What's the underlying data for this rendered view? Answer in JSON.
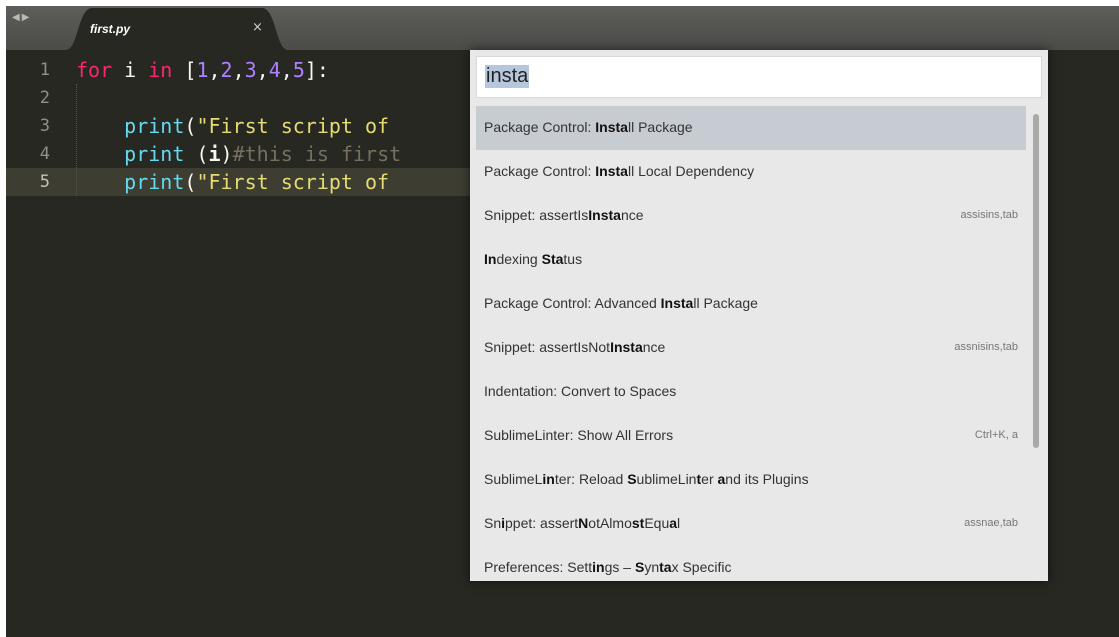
{
  "tabs": [
    {
      "title": "first.py",
      "close": "×"
    }
  ],
  "nav_arrows": "◀▶",
  "editor": {
    "line_numbers": [
      "1",
      "2",
      "3",
      "4",
      "5"
    ],
    "active_line": "5"
  },
  "palette": {
    "query": "insta",
    "results": [
      {
        "segments": [
          {
            "t": "Package Control: ",
            "b": false
          },
          {
            "t": "Insta",
            "b": true
          },
          {
            "t": "ll Package",
            "b": false
          }
        ],
        "hint": ""
      },
      {
        "segments": [
          {
            "t": "Package Control: ",
            "b": false
          },
          {
            "t": "Insta",
            "b": true
          },
          {
            "t": "ll Local Dependency",
            "b": false
          }
        ],
        "hint": ""
      },
      {
        "segments": [
          {
            "t": "Snippet: assertIs",
            "b": false
          },
          {
            "t": "Insta",
            "b": true
          },
          {
            "t": "nce",
            "b": false
          }
        ],
        "hint": "assisins,tab"
      },
      {
        "segments": [
          {
            "t": "In",
            "b": true
          },
          {
            "t": "dexing ",
            "b": false
          },
          {
            "t": "Sta",
            "b": true
          },
          {
            "t": "tus",
            "b": false
          }
        ],
        "hint": ""
      },
      {
        "segments": [
          {
            "t": "Package Control: Advanced ",
            "b": false
          },
          {
            "t": "Insta",
            "b": true
          },
          {
            "t": "ll Package",
            "b": false
          }
        ],
        "hint": ""
      },
      {
        "segments": [
          {
            "t": "Snippet: assertIsNot",
            "b": false
          },
          {
            "t": "Insta",
            "b": true
          },
          {
            "t": "nce",
            "b": false
          }
        ],
        "hint": "assnisins,tab"
      },
      {
        "segments": [
          {
            "t": "Indentation: Convert to Spaces",
            "b": false
          }
        ],
        "hint": ""
      },
      {
        "segments": [
          {
            "t": "SublimeLinter: Show All Errors",
            "b": false
          }
        ],
        "hint": "Ctrl+K, a"
      },
      {
        "segments": [
          {
            "t": "SublimeL",
            "b": false
          },
          {
            "t": "in",
            "b": true
          },
          {
            "t": "ter: Reload ",
            "b": false
          },
          {
            "t": "S",
            "b": true
          },
          {
            "t": "ublimeLin",
            "b": false
          },
          {
            "t": "t",
            "b": true
          },
          {
            "t": "er ",
            "b": false
          },
          {
            "t": "a",
            "b": true
          },
          {
            "t": "nd its Plugins",
            "b": false
          }
        ],
        "hint": ""
      },
      {
        "segments": [
          {
            "t": "Sn",
            "b": false
          },
          {
            "t": "i",
            "b": true
          },
          {
            "t": "ppet: assert",
            "b": false
          },
          {
            "t": "N",
            "b": true
          },
          {
            "t": "otAlmo",
            "b": false
          },
          {
            "t": "st",
            "b": true
          },
          {
            "t": "Equ",
            "b": false
          },
          {
            "t": "a",
            "b": true
          },
          {
            "t": "l",
            "b": false
          }
        ],
        "hint": "assnae,tab"
      },
      {
        "segments": [
          {
            "t": "Preferences: Sett",
            "b": false
          },
          {
            "t": "in",
            "b": true
          },
          {
            "t": "gs – ",
            "b": false
          },
          {
            "t": "S",
            "b": true
          },
          {
            "t": "yn",
            "b": false
          },
          {
            "t": "ta",
            "b": true
          },
          {
            "t": "x Specific",
            "b": false
          }
        ],
        "hint": ""
      }
    ],
    "selected_index": 0
  },
  "code_lines": [
    [
      {
        "t": "for",
        "c": "kw"
      },
      {
        "t": " i ",
        "c": "pl"
      },
      {
        "t": "in",
        "c": "kw"
      },
      {
        "t": " [",
        "c": "pl"
      },
      {
        "t": "1",
        "c": "nm"
      },
      {
        "t": ",",
        "c": "pl"
      },
      {
        "t": "2",
        "c": "nm"
      },
      {
        "t": ",",
        "c": "pl"
      },
      {
        "t": "3",
        "c": "nm"
      },
      {
        "t": ",",
        "c": "pl"
      },
      {
        "t": "4",
        "c": "nm"
      },
      {
        "t": ",",
        "c": "pl"
      },
      {
        "t": "5",
        "c": "nm"
      },
      {
        "t": "]:",
        "c": "pl"
      }
    ],
    [],
    [
      {
        "t": "    ",
        "c": "pl"
      },
      {
        "t": "print",
        "c": "fn"
      },
      {
        "t": "(",
        "c": "pl"
      },
      {
        "t": "\"First script of",
        "c": "st"
      }
    ],
    [
      {
        "t": "    ",
        "c": "pl"
      },
      {
        "t": "print",
        "c": "fn"
      },
      {
        "t": " (",
        "c": "pl"
      },
      {
        "t": "i",
        "c": "pl bold"
      },
      {
        "t": ")",
        "c": "pl"
      },
      {
        "t": "#this is first",
        "c": "cm"
      }
    ],
    [
      {
        "t": "    ",
        "c": "pl"
      },
      {
        "t": "print",
        "c": "fn"
      },
      {
        "t": "(",
        "c": "pl"
      },
      {
        "t": "\"First script of",
        "c": "st"
      }
    ]
  ],
  "colors": {
    "editor_bg": "#272822",
    "keyword": "#f92672",
    "function": "#66d9ef",
    "string": "#e6db74",
    "number": "#ae81ff",
    "comment": "#75715e"
  }
}
